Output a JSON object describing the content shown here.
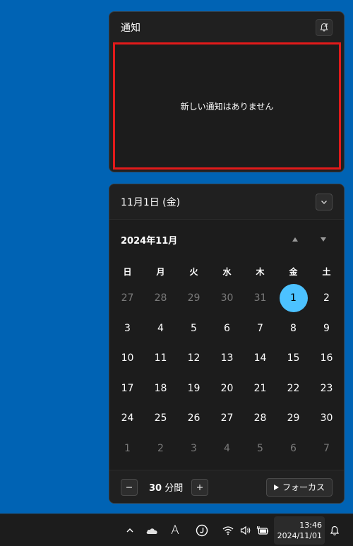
{
  "notifications": {
    "title": "通知",
    "empty_message": "新しい通知はありません"
  },
  "calendar": {
    "date_label": "11月1日 (金)",
    "month_title": "2024年11月",
    "weekdays": [
      "日",
      "月",
      "火",
      "水",
      "木",
      "金",
      "土"
    ],
    "weeks": [
      [
        {
          "d": "27",
          "other": true
        },
        {
          "d": "28",
          "other": true
        },
        {
          "d": "29",
          "other": true
        },
        {
          "d": "30",
          "other": true
        },
        {
          "d": "31",
          "other": true
        },
        {
          "d": "1",
          "today": true
        },
        {
          "d": "2"
        }
      ],
      [
        {
          "d": "3"
        },
        {
          "d": "4"
        },
        {
          "d": "5"
        },
        {
          "d": "6"
        },
        {
          "d": "7"
        },
        {
          "d": "8"
        },
        {
          "d": "9"
        }
      ],
      [
        {
          "d": "10"
        },
        {
          "d": "11"
        },
        {
          "d": "12"
        },
        {
          "d": "13"
        },
        {
          "d": "14"
        },
        {
          "d": "15"
        },
        {
          "d": "16"
        }
      ],
      [
        {
          "d": "17"
        },
        {
          "d": "18"
        },
        {
          "d": "19"
        },
        {
          "d": "20"
        },
        {
          "d": "21"
        },
        {
          "d": "22"
        },
        {
          "d": "23"
        }
      ],
      [
        {
          "d": "24"
        },
        {
          "d": "25"
        },
        {
          "d": "26"
        },
        {
          "d": "27"
        },
        {
          "d": "28"
        },
        {
          "d": "29"
        },
        {
          "d": "30"
        }
      ],
      [
        {
          "d": "1",
          "other": true
        },
        {
          "d": "2",
          "other": true
        },
        {
          "d": "3",
          "other": true
        },
        {
          "d": "4",
          "other": true
        },
        {
          "d": "5",
          "other": true
        },
        {
          "d": "6",
          "other": true
        },
        {
          "d": "7",
          "other": true
        }
      ]
    ]
  },
  "focus": {
    "minutes": "30",
    "unit": "分間",
    "button_label": "フォーカス"
  },
  "taskbar": {
    "ime_indicator": "A",
    "time": "13:46",
    "date": "2024/11/01"
  },
  "colors": {
    "desktop": "#0063b4",
    "today_accent": "#4cc2ff",
    "highlight_border": "#e21a1a"
  },
  "icons": [
    "bell-snooze-icon",
    "chevron-down-icon",
    "triangle-up-icon",
    "triangle-down-icon",
    "minus-icon",
    "plus-icon",
    "play-icon",
    "chevron-up-icon",
    "onedrive-cloud-icon",
    "ime-mode-icon",
    "app-j-icon",
    "wifi-icon",
    "volume-icon",
    "battery-plug-icon",
    "bell-icon"
  ]
}
